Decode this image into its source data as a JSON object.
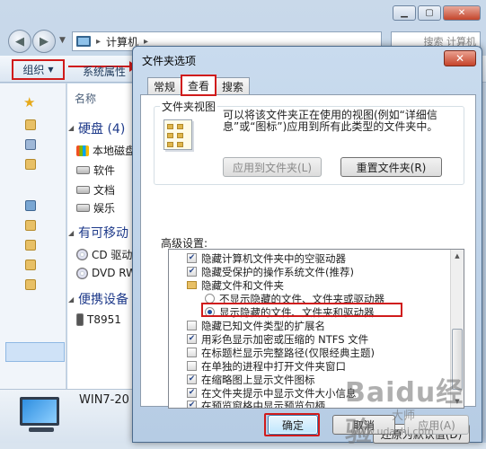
{
  "explorer": {
    "breadcrumb_root": "计算机",
    "search_placeholder": "搜索 计算机",
    "toolbar": {
      "organize": "组织",
      "system_properties": "系统属性"
    },
    "column_header": "名称",
    "groups": [
      {
        "label": "硬盘 (4)"
      },
      {
        "label": "有可移动"
      },
      {
        "label": "便携设备"
      }
    ],
    "drives": [
      {
        "label": "本地磁盘"
      },
      {
        "label": "软件"
      },
      {
        "label": "文档"
      },
      {
        "label": "娱乐"
      },
      {
        "label": "CD 驱动"
      },
      {
        "label": "DVD RW"
      },
      {
        "label": "T8951"
      }
    ],
    "computer_name": "WIN7-20"
  },
  "dialog": {
    "title": "文件夹选项",
    "close": "✕",
    "tabs": [
      {
        "label": "常规",
        "active": false
      },
      {
        "label": "查看",
        "active": true
      },
      {
        "label": "搜索",
        "active": false
      }
    ],
    "folder_views": {
      "legend": "文件夹视图",
      "description": "可以将该文件夹正在使用的视图(例如“详细信息”或“图标”)应用到所有此类型的文件夹中。",
      "apply_button": "应用到文件夹(L)",
      "reset_button": "重置文件夹(R)"
    },
    "advanced_label": "高级设置:",
    "settings": [
      {
        "type": "checkbox",
        "checked": true,
        "label": "隐藏计算机文件夹中的空驱动器"
      },
      {
        "type": "checkbox",
        "checked": true,
        "label": "隐藏受保护的操作系统文件(推荐)"
      },
      {
        "type": "folder",
        "label": "隐藏文件和文件夹"
      },
      {
        "type": "radio",
        "checked": false,
        "label": "不显示隐藏的文件、文件夹或驱动器"
      },
      {
        "type": "radio",
        "checked": true,
        "label": "显示隐藏的文件、文件夹和驱动器"
      },
      {
        "type": "checkbox",
        "checked": false,
        "label": "隐藏已知文件类型的扩展名"
      },
      {
        "type": "checkbox",
        "checked": true,
        "label": "用彩色显示加密或压缩的 NTFS 文件"
      },
      {
        "type": "checkbox",
        "checked": false,
        "label": "在标题栏显示完整路径(仅限经典主题)"
      },
      {
        "type": "checkbox",
        "checked": false,
        "label": "在单独的进程中打开文件夹窗口"
      },
      {
        "type": "checkbox",
        "checked": true,
        "label": "在缩略图上显示文件图标"
      },
      {
        "type": "checkbox",
        "checked": true,
        "label": "在文件夹提示中显示文件大小信息"
      },
      {
        "type": "checkbox",
        "checked": true,
        "label": "在预览窗格中显示预览句柄"
      }
    ],
    "restore_defaults": "还原为默认值(D)",
    "ok": "确定",
    "cancel": "取消",
    "apply": "应用(A)"
  },
  "watermark": {
    "brand": "Baidu经验",
    "sub": "大师",
    "url": "www.udashi.com"
  },
  "colors": {
    "highlight": "#d01b1b",
    "accent": "#3c7fb1"
  }
}
